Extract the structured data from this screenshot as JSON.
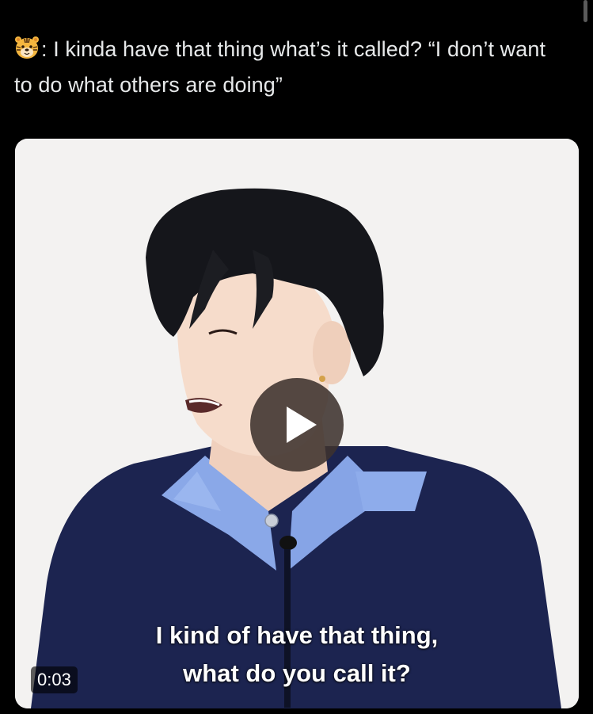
{
  "tweet": {
    "emoji": "tiger-face",
    "text": ": I kinda have that thing what’s it called? “I don’t want to do what others are doing”"
  },
  "media": {
    "caption_line1": "I kind of have that thing,",
    "caption_line2": "what do you call it?",
    "duration": "0:03",
    "play_icon": "play-icon"
  },
  "colors": {
    "background": "#000000",
    "text": "#e7e9ea",
    "media_background": "#f3f2f1",
    "shirt": "#8aa8e8",
    "sweater": "#1c2450"
  }
}
